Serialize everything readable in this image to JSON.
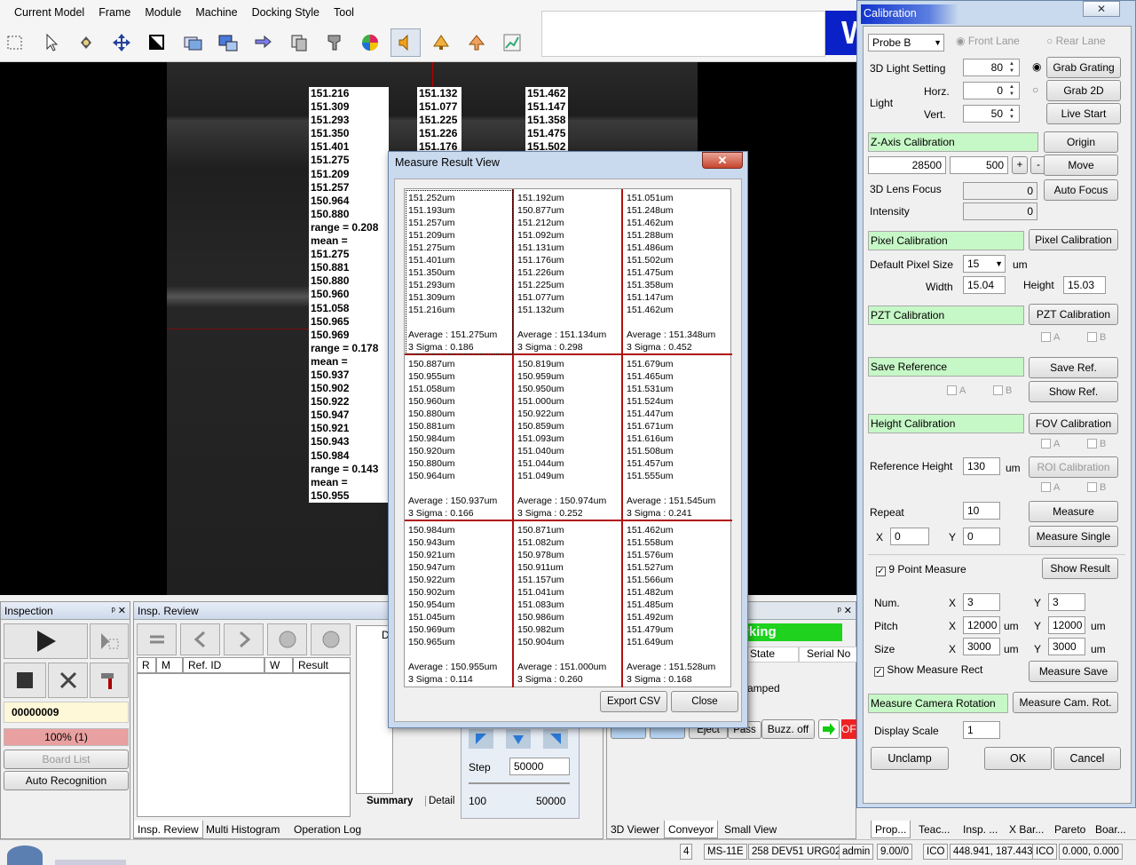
{
  "menu": [
    "Current Model",
    "Frame",
    "Module",
    "Machine",
    "Docking Style",
    "Tool"
  ],
  "toolbar_icons": [
    "select-rect-icon",
    "pointer-icon",
    "pan-icon",
    "move-icon",
    "crop-icon",
    "windows-icon",
    "screens-icon",
    "swap-icon",
    "copy-icon",
    "stamp-icon",
    "color-icon",
    "speaker-icon",
    "light-icon",
    "light2-icon",
    "chart-icon"
  ],
  "logo_text": "W",
  "measure_cols": {
    "c1a": [
      "151.216",
      "151.309",
      "151.293",
      "151.350",
      "151.401",
      "151.275",
      "151.209",
      "151.257",
      "150.964",
      "150.880",
      "range = 0.208",
      "mean = 151.275",
      "150.881",
      "150.880",
      "150.960",
      "151.058",
      "150.965",
      "150.969",
      "range = 0.178",
      "mean = 150.937",
      "150.902",
      "150.922",
      "150.947",
      "150.921",
      "150.943",
      "150.984",
      "range = 0.143",
      "mean = 150.955"
    ],
    "c2": [
      "151.132",
      "151.077",
      "151.225",
      "151.226",
      "151.176"
    ],
    "c3": [
      "151.462",
      "151.147",
      "151.358",
      "151.475",
      "151.502"
    ]
  },
  "dialog": {
    "title": "Measure Result View",
    "close_glyph": "✕",
    "cells": [
      {
        "values": [
          "151.252um",
          "151.193um",
          "151.257um",
          "151.209um",
          "151.275um",
          "151.401um",
          "151.350um",
          "151.293um",
          "151.309um",
          "151.216um"
        ],
        "average": "Average : 151.275um",
        "sigma": "3 Sigma : 0.186"
      },
      {
        "values": [
          "151.192um",
          "150.877um",
          "151.212um",
          "151.092um",
          "151.131um",
          "151.176um",
          "151.226um",
          "151.225um",
          "151.077um",
          "151.132um"
        ],
        "average": "Average : 151.134um",
        "sigma": "3 Sigma : 0.298"
      },
      {
        "values": [
          "151.051um",
          "151.248um",
          "151.462um",
          "151.288um",
          "151.486um",
          "151.502um",
          "151.475um",
          "151.358um",
          "151.147um",
          "151.462um"
        ],
        "average": "Average : 151.348um",
        "sigma": "3 Sigma : 0.452"
      },
      {
        "values": [
          "150.887um",
          "150.955um",
          "151.058um",
          "150.960um",
          "150.880um",
          "150.881um",
          "150.984um",
          "150.920um",
          "150.880um",
          "150.964um"
        ],
        "average": "Average : 150.937um",
        "sigma": "3 Sigma : 0.166"
      },
      {
        "values": [
          "150.819um",
          "150.959um",
          "150.950um",
          "151.000um",
          "150.922um",
          "150.859um",
          "151.093um",
          "151.040um",
          "151.044um",
          "151.049um"
        ],
        "average": "Average : 150.974um",
        "sigma": "3 Sigma : 0.252"
      },
      {
        "values": [
          "151.679um",
          "151.465um",
          "151.531um",
          "151.524um",
          "151.447um",
          "151.671um",
          "151.616um",
          "151.508um",
          "151.457um",
          "151.555um"
        ],
        "average": "Average : 151.545um",
        "sigma": "3 Sigma : 0.241"
      },
      {
        "values": [
          "150.984um",
          "150.943um",
          "150.921um",
          "150.947um",
          "150.922um",
          "150.902um",
          "150.954um",
          "151.045um",
          "150.969um",
          "150.965um"
        ],
        "average": "Average : 150.955um",
        "sigma": "3 Sigma : 0.114"
      },
      {
        "values": [
          "150.871um",
          "151.082um",
          "150.978um",
          "150.911um",
          "151.157um",
          "151.041um",
          "151.083um",
          "150.986um",
          "150.982um",
          "150.904um"
        ],
        "average": "Average : 151.000um",
        "sigma": "3 Sigma : 0.260"
      },
      {
        "values": [
          "151.462um",
          "151.558um",
          "151.576um",
          "151.527um",
          "151.566um",
          "151.482um",
          "151.485um",
          "151.492um",
          "151.479um",
          "151.649um"
        ],
        "average": "Average : 151.528um",
        "sigma": "3 Sigma : 0.168"
      }
    ],
    "export_label": "Export CSV",
    "close_label": "Close"
  },
  "inspection": {
    "title": "Inspection",
    "pin": "ᵖ ✕",
    "board_id": "00000009",
    "progress_text": "100% (1)",
    "progress": 1.0,
    "board_list": "Board List",
    "auto_recognition": "Auto Recognition"
  },
  "insp_review": {
    "title": "Insp. Review",
    "columns": [
      "R",
      "M",
      "Ref. ID",
      "W",
      "Result"
    ],
    "tab_summary": "Summary",
    "tab_detail": "Detail",
    "step_label": "Step",
    "step_value": "50000",
    "range_min": "100",
    "range_max": "50000",
    "d_label": "D"
  },
  "status_panel": {
    "working": "rking",
    "state": "State",
    "serial": "Serial No",
    "clamped": "amped",
    "eject": "Eject",
    "pass": "Pass",
    "buzz": "Buzz. off",
    "off": "OF"
  },
  "bottom_tabs_left": [
    "Insp. Review",
    "Multi Histogram",
    "Operation Log"
  ],
  "bottom_tabs_mid": [
    "3D Viewer",
    "Conveyor",
    "Small View"
  ],
  "bottom_tabs_right": [
    "Prop...",
    "Teac...",
    "Insp. ...",
    "X Bar...",
    "Pareto",
    "Boar..."
  ],
  "statusbar": [
    "4",
    "MS-11E",
    "258 DEV51 URG02",
    "admin",
    "9.00/0",
    "ICO",
    "448.941, 187.443",
    "ICO",
    "0.000, 0.000"
  ],
  "calibration": {
    "title": "Calibration",
    "close_glyph": "✕",
    "probe": "Probe B",
    "front_lane": "Front Lane",
    "rear_lane": "Rear Lane",
    "light_setting_label": "3D Light Setting",
    "light_setting_value": "80",
    "grab_grating": "Grab Grating",
    "light_label": "Light",
    "horz_label": "Horz.",
    "horz_value": "0",
    "grab_2d": "Grab 2D",
    "vert_label": "Vert.",
    "vert_value": "50",
    "live_start": "Live Start",
    "z_axis": "Z-Axis Calibration",
    "origin": "Origin",
    "z_value1": "28500",
    "z_value2": "500",
    "plus": "+",
    "minus": "-",
    "move": "Move",
    "lens_focus_label": "3D Lens Focus",
    "lens_focus_value": "0",
    "auto_focus": "Auto Focus",
    "intensity_label": "Intensity",
    "intensity_value": "0",
    "pixel_cal": "Pixel Calibration",
    "pixel_cal_btn": "Pixel Calibration",
    "default_pixel_label": "Default Pixel Size",
    "default_pixel_value": "15",
    "um": "um",
    "width_label": "Width",
    "width_value": "15.04",
    "height_label": "Height",
    "height_value": "15.03",
    "pzt_cal": "PZT Calibration",
    "pzt_cal_btn": "PZT Calibration",
    "a": "A",
    "b": "B",
    "save_ref": "Save Reference",
    "save_ref_btn": "Save Ref.",
    "show_ref_btn": "Show Ref.",
    "height_cal": "Height Calibration",
    "fov_cal_btn": "FOV Calibration",
    "ref_height_label": "Reference Height",
    "ref_height_value": "130",
    "roi_cal_btn": "ROI Calibration",
    "repeat_label": "Repeat",
    "repeat_value": "10",
    "measure_btn": "Measure",
    "x_label": "X",
    "y_label": "Y",
    "x_value": "0",
    "y_value": "0",
    "measure_single_btn": "Measure Single",
    "nine_point": "9 Point Measure",
    "show_result_btn": "Show Result",
    "num_label": "Num.",
    "num_x": "3",
    "num_y": "3",
    "pitch_label": "Pitch",
    "pitch_x": "12000",
    "pitch_y": "12000",
    "size_label": "Size",
    "size_x": "3000",
    "size_y": "3000",
    "show_measure_rect": "Show Measure Rect",
    "measure_save_btn": "Measure Save",
    "cam_rot": "Measure Camera Rotation",
    "cam_rot_btn": "Measure Cam. Rot.",
    "display_scale_label": "Display Scale",
    "display_scale_value": "1",
    "unclamp": "Unclamp",
    "ok": "OK",
    "cancel": "Cancel"
  }
}
